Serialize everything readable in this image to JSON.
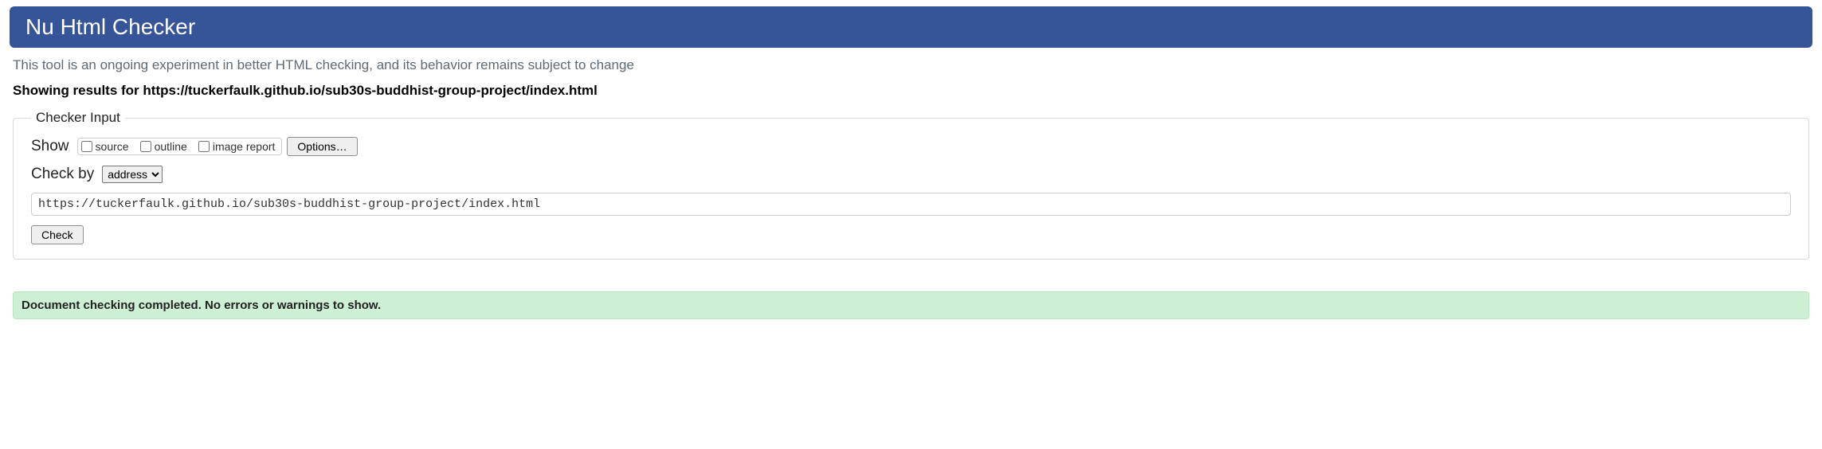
{
  "banner": {
    "title": "Nu Html Checker"
  },
  "intro": "This tool is an ongoing experiment in better HTML checking, and its behavior remains subject to change",
  "results_heading_prefix": "Showing results for ",
  "results_heading_url": "https://tuckerfaulk.github.io/sub30s-buddhist-group-project/index.html",
  "checker": {
    "legend": "Checker Input",
    "show_label": "Show",
    "cb_source": "source",
    "cb_outline": "outline",
    "cb_image": "image report",
    "options_btn": "Options…",
    "checkby_label": "Check by",
    "checkby_selected": "address",
    "url_value": "https://tuckerfaulk.github.io/sub30s-buddhist-group-project/index.html",
    "check_btn": "Check"
  },
  "success_msg": "Document checking completed. No errors or warnings to show."
}
